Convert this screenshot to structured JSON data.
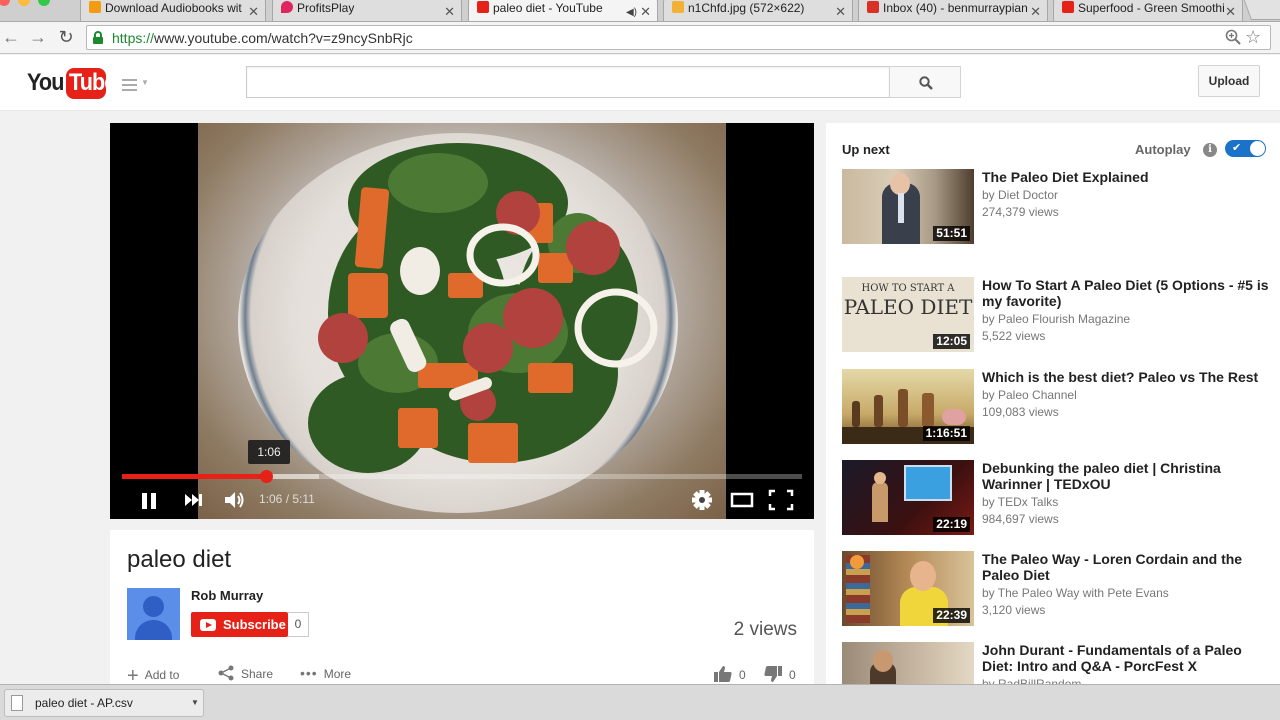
{
  "browser": {
    "tabs": [
      {
        "title": "Download Audiobooks wit",
        "favicon_color": "#f39c12",
        "active": false
      },
      {
        "title": "ProfitsPlay",
        "favicon_color": "#e0245e",
        "active": false
      },
      {
        "title": "paleo diet - YouTube",
        "favicon_color": "#e62117",
        "active": true
      },
      {
        "title": "n1Chfd.jpg (572×622)",
        "favicon_color": "#f2b134",
        "active": false
      },
      {
        "title": "Inbox (40) - benmurraypian",
        "favicon_color": "#d93025",
        "active": false
      },
      {
        "title": "Superfood - Green Smoothi",
        "favicon_color": "#e62117",
        "active": false
      }
    ],
    "url_scheme": "https://",
    "url_rest": "www.youtube.com/watch?v=z9ncySnbRjc"
  },
  "header": {
    "logo_you": "You",
    "logo_tube": "Tube",
    "search_placeholder": "",
    "upload_label": "Upload"
  },
  "player": {
    "tooltip_time": "1:06",
    "time_display": "1:06 / 5:11",
    "progress_fraction": 0.212,
    "buffered_fraction": 0.29
  },
  "video": {
    "title": "paleo diet",
    "channel": "Rob Murray",
    "subscribe_label": "Subscribe",
    "subscriber_count": "0",
    "views": "2 views",
    "actions": {
      "add_to": "Add to",
      "share": "Share",
      "more": "More",
      "likes": "0",
      "dislikes": "0"
    }
  },
  "sidebar": {
    "up_next_label": "Up next",
    "autoplay_label": "Autoplay",
    "info_glyph": "i",
    "autoplay_on": true,
    "videos": [
      {
        "title": "The Paleo Diet Explained",
        "channel": "by Diet Doctor",
        "views": "274,379 views",
        "duration": "51:51"
      },
      {
        "title": "How To Start A Paleo Diet (5 Options - #5 is my favorite)",
        "channel": "by Paleo Flourish Magazine",
        "views": "5,522 views",
        "duration": "12:05",
        "thumb_text_small": "HOW TO START A",
        "thumb_text_big": "PALEO DIET"
      },
      {
        "title": "Which is the best diet? Paleo vs The Rest",
        "channel": "by Paleo Channel",
        "views": "109,083 views",
        "duration": "1:16:51"
      },
      {
        "title": "Debunking the paleo diet | Christina Warinner | TEDxOU",
        "channel": "by TEDx Talks",
        "views": "984,697 views",
        "duration": "22:19"
      },
      {
        "title": "The Paleo Way - Loren Cordain and the Paleo Diet",
        "channel": "by The Paleo Way with Pete Evans",
        "views": "3,120 views",
        "duration": "22:39"
      },
      {
        "title": "John Durant - Fundamentals of a Paleo Diet: Intro and Q&A - PorcFest X",
        "channel": "by RadBillRandom",
        "views": "",
        "duration": ""
      }
    ]
  },
  "download": {
    "filename": "paleo diet - AP.csv"
  }
}
